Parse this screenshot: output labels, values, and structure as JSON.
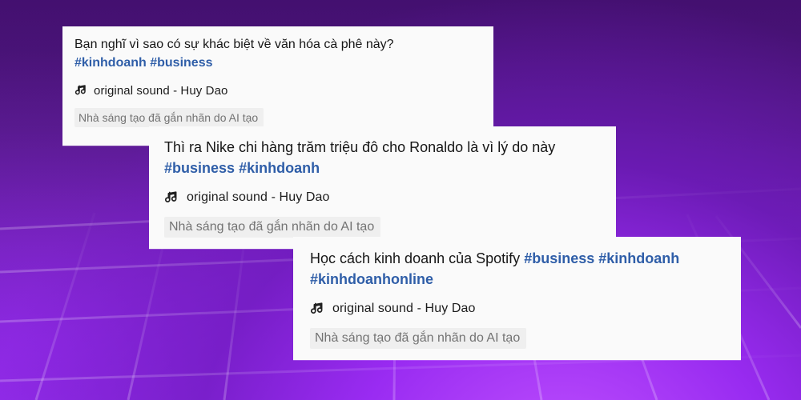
{
  "posts": [
    {
      "caption_text": "Bạn nghĩ vì sao có sự khác biệt về văn hóa cà phê này?",
      "hashtags": [
        "#kinhdoanh",
        "#business"
      ],
      "sound": {
        "icon": "music-note-icon",
        "label": "original sound - Huy Dao"
      },
      "ai_label": "Nhà sáng tạo đã gắn nhãn do AI tạo"
    },
    {
      "caption_text": "Thì ra Nike chi hàng trăm triệu đô cho Ronaldo là vì lý do này",
      "hashtags": [
        "#business",
        "#kinhdoanh"
      ],
      "sound": {
        "icon": "music-note-icon",
        "label": "original sound - Huy Dao"
      },
      "ai_label": "Nhà sáng tạo đã gắn nhãn do AI tạo"
    },
    {
      "caption_text": "Học cách kinh doanh của Spotify",
      "hashtags": [
        "#business",
        "#kinhdoanh",
        "#kinhdoanhonline"
      ],
      "sound": {
        "icon": "music-note-icon",
        "label": "original sound - Huy Dao"
      },
      "ai_label": "Nhà sáng tạo đã gắn nhãn do AI tạo"
    }
  ],
  "colors": {
    "background_primary": "#4b137b",
    "background_accent": "#9b2bf4",
    "card_background": "#fafafa",
    "text_primary": "#161616",
    "hashtag": "#2f5ea8",
    "badge_background": "#efefef",
    "badge_text": "#737373"
  }
}
